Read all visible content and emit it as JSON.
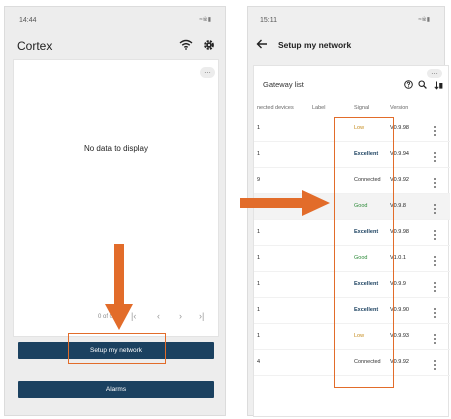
{
  "left_screen": {
    "status_time": "14:44",
    "app_title": "Cortex",
    "empty_message": "No data to display",
    "pager": {
      "count": "0 of 0"
    },
    "buttons": {
      "setup": "Setup my network",
      "alarms": "Alarms"
    }
  },
  "right_screen": {
    "status_time": "15:11",
    "title": "Setup my network",
    "gateway_list": {
      "title": "Gateway list",
      "columns": [
        "nected devices",
        "Label",
        "Signal",
        "Version"
      ],
      "rows": [
        {
          "devices": "1",
          "label": "",
          "signal": "Low",
          "version": "V0.9.98"
        },
        {
          "devices": "1",
          "label": "",
          "signal": "Excellent",
          "version": "V0.9.94"
        },
        {
          "devices": "9",
          "label": "",
          "signal": "Connected",
          "version": "V0.9.92"
        },
        {
          "devices": "1",
          "label": "",
          "signal": "Good",
          "version": "V0.9.8"
        },
        {
          "devices": "1",
          "label": "",
          "signal": "Excellent",
          "version": "V0.9.98"
        },
        {
          "devices": "1",
          "label": "",
          "signal": "Good",
          "version": "V1.0.1"
        },
        {
          "devices": "1",
          "label": "",
          "signal": "Excellent",
          "version": "V0.9.9"
        },
        {
          "devices": "1",
          "label": "",
          "signal": "Excellent",
          "version": "V0.9.90"
        },
        {
          "devices": "1",
          "label": "",
          "signal": "Low",
          "version": "V0.9.93"
        },
        {
          "devices": "4",
          "label": "",
          "signal": "Connected",
          "version": "V0.9.92"
        }
      ]
    }
  },
  "icons": [
    "wifi-icon",
    "gear-icon",
    "more-icon",
    "first-page-icon",
    "prev-page-icon",
    "next-page-icon",
    "last-page-icon",
    "back-arrow-icon",
    "help-icon",
    "search-icon",
    "sort-down-icon",
    "kebab-icon"
  ],
  "colors": {
    "primary_button": "#1b4160",
    "annotation": "#e26c2a",
    "signal_low": "#c58b1c",
    "signal_excellent": "#1b4160",
    "signal_good": "#2e8b3a"
  }
}
